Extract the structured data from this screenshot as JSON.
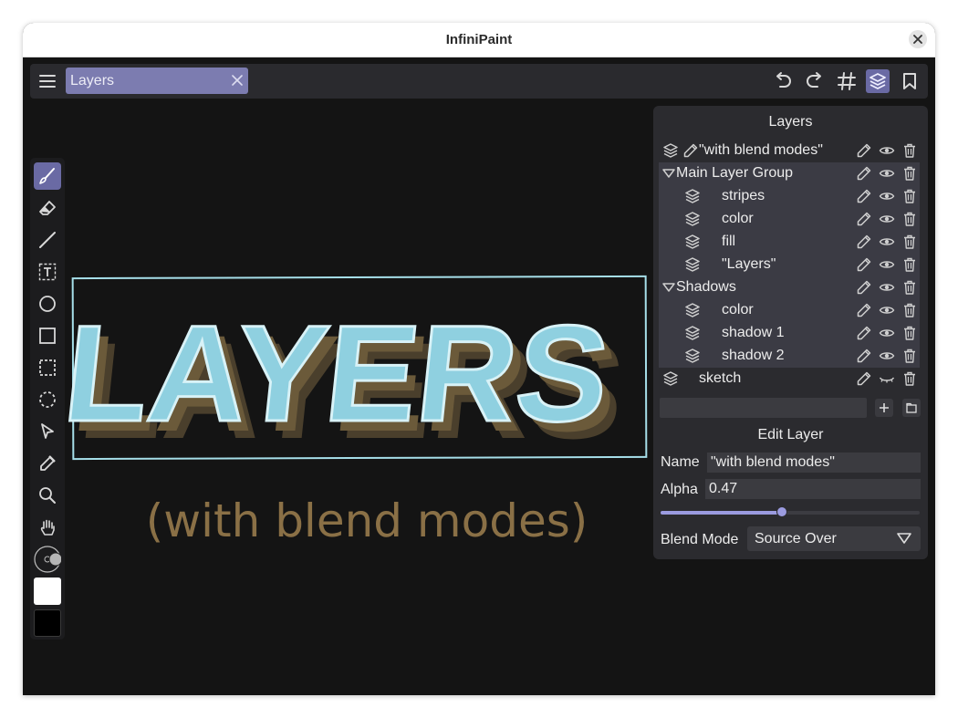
{
  "window": {
    "title": "InfiniPaint"
  },
  "toolbar": {
    "tab_label": "Layers",
    "icons": [
      "menu-icon",
      "close-icon",
      "undo-icon",
      "redo-icon",
      "grid-icon",
      "layers-icon",
      "bookmark-icon"
    ],
    "active_icon": "layers-icon"
  },
  "tools": {
    "items": [
      "brush-icon",
      "eraser-icon",
      "line-icon",
      "text-tool-icon",
      "ellipse-icon",
      "rectangle-icon",
      "rect-select-icon",
      "lasso-select-icon",
      "pointer-icon",
      "eyedropper-icon",
      "zoom-icon",
      "hand-icon",
      "brush-size-icon"
    ],
    "active": "brush-icon",
    "primary_color": "#ffffff",
    "secondary_color": "#000000"
  },
  "artwork": {
    "headline": "LAYERS",
    "subtitle": "(with blend modes)",
    "headline_color": "#8fd0e0",
    "shadow_color": "#6b5a3a",
    "subtitle_color": "#8a7046",
    "frame_color": "#a6dfe9"
  },
  "layers_panel": {
    "title": "Layers",
    "rows": [
      {
        "label": "\"with blend modes\"",
        "kind": "layer",
        "selected": true
      },
      {
        "label": "Main Layer Group",
        "kind": "group"
      },
      {
        "label": "stripes",
        "kind": "child"
      },
      {
        "label": "color",
        "kind": "child"
      },
      {
        "label": "fill",
        "kind": "child"
      },
      {
        "label": "\"Layers\"",
        "kind": "child"
      },
      {
        "label": "Shadows",
        "kind": "group"
      },
      {
        "label": "color",
        "kind": "child"
      },
      {
        "label": "shadow 1",
        "kind": "child"
      },
      {
        "label": "shadow 2",
        "kind": "child"
      },
      {
        "label": "sketch",
        "kind": "layer",
        "hidden": true
      }
    ],
    "new_layer_name": ""
  },
  "edit_layer": {
    "title": "Edit Layer",
    "name_label": "Name",
    "name_value": "\"with blend modes\"",
    "alpha_label": "Alpha",
    "alpha_value": "0.47",
    "alpha": 0.47,
    "blend_mode_label": "Blend Mode",
    "blend_mode_value": "Source Over"
  },
  "colors": {
    "accent": "#7c7cb0",
    "panel": "#2b2b2f",
    "canvas": "#141414"
  }
}
